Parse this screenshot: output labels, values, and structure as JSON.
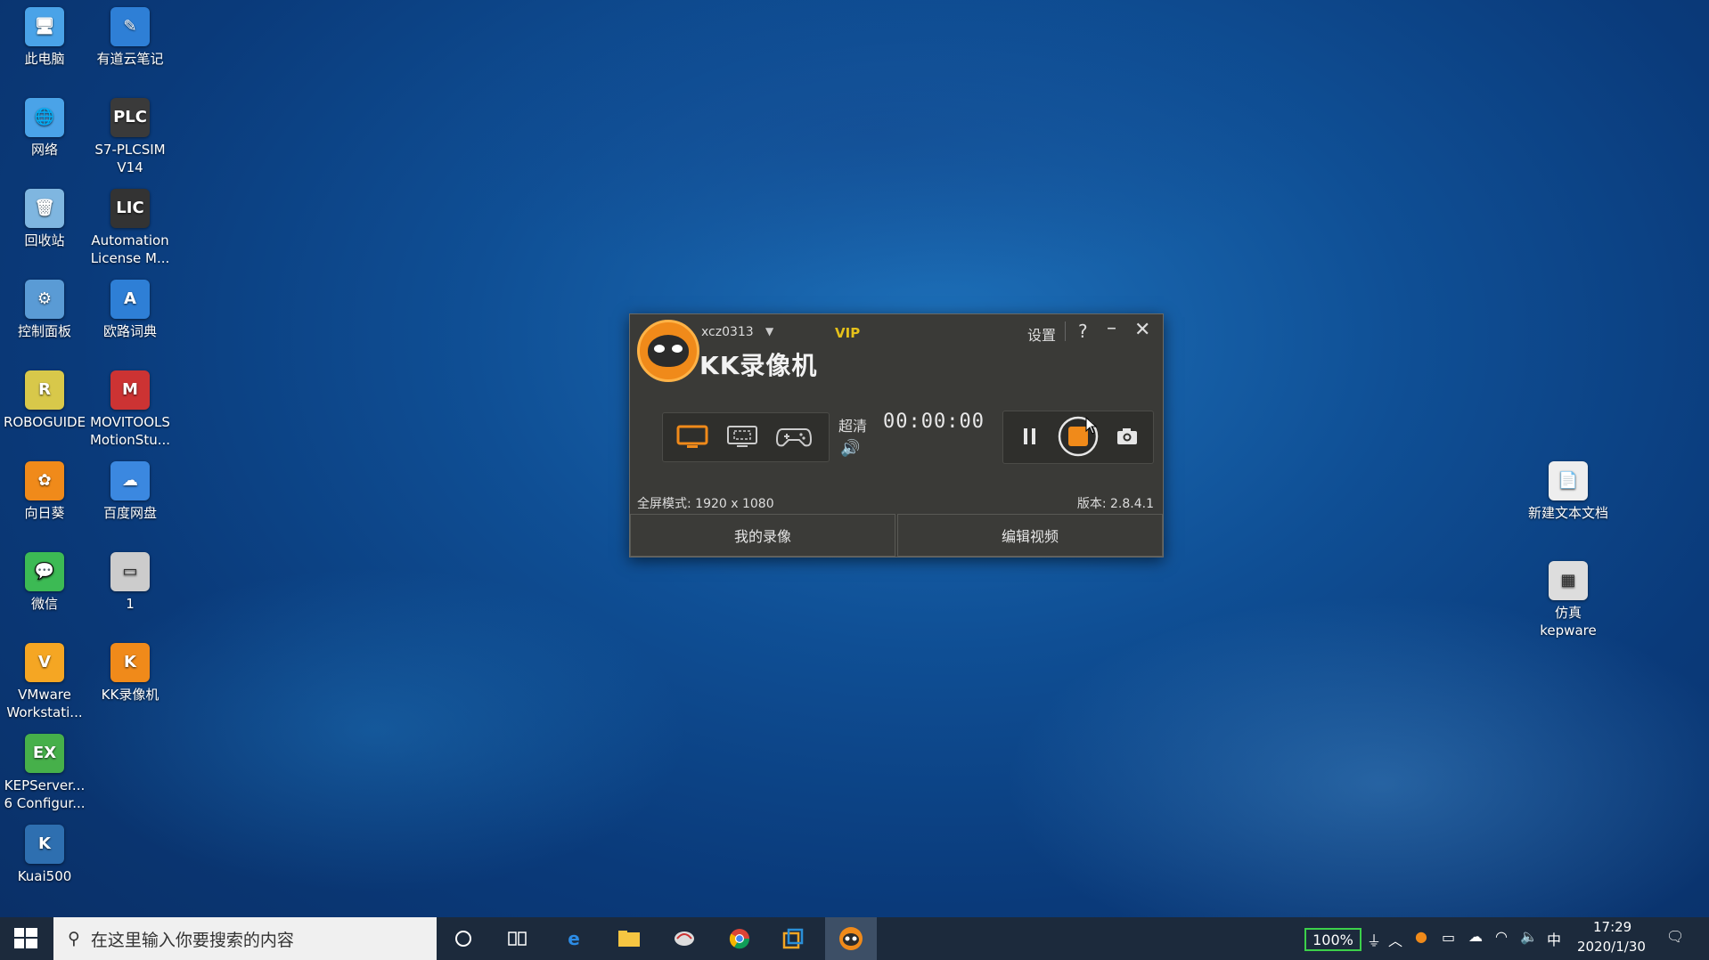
{
  "desktop": {
    "icons": [
      {
        "label": "此电脑",
        "glyph": "🖥"
      },
      {
        "label": "有道云笔记",
        "glyph": "✎"
      },
      {
        "label": "网络",
        "glyph": "🌐"
      },
      {
        "label": "S7-PLCSIM V14",
        "glyph": "PLC"
      },
      {
        "label": "回收站",
        "glyph": "🗑"
      },
      {
        "label": "Automation License M...",
        "glyph": "LIC"
      },
      {
        "label": "控制面板",
        "glyph": "⚙"
      },
      {
        "label": "欧路词典",
        "glyph": "A"
      },
      {
        "label": "ROBOGUIDE",
        "glyph": "R"
      },
      {
        "label": "MOVITOOLS MotionStu...",
        "glyph": "M"
      },
      {
        "label": "向日葵",
        "glyph": "✿"
      },
      {
        "label": "百度网盘",
        "glyph": "☁"
      },
      {
        "label": "微信",
        "glyph": "💬"
      },
      {
        "label": "1",
        "glyph": "▭"
      },
      {
        "label": "VMware Workstati...",
        "glyph": "V"
      },
      {
        "label": "KK录像机",
        "glyph": "K"
      },
      {
        "label": "KEPServer... 6 Configur...",
        "glyph": "EX"
      },
      {
        "label": "Kuai500",
        "glyph": "K"
      },
      {
        "label": "新建文本文档",
        "glyph": "📄"
      },
      {
        "label": "仿真 kepware",
        "glyph": "▦"
      }
    ]
  },
  "kk": {
    "username": "xcz0313",
    "vip": "VIP",
    "settings": "设置",
    "help": "?",
    "minimize": "–",
    "close": "✕",
    "title": "KK录像机",
    "quality": "超清",
    "timer": "00:00:00",
    "info_left": "全屏模式: 1920 x 1080",
    "info_right": "版本: 2.8.4.1",
    "tab_my_recordings": "我的录像",
    "tab_edit_video": "编辑视频"
  },
  "taskbar": {
    "search_placeholder": "在这里输入你要搜索的内容",
    "battery": "100%",
    "ime": "中",
    "time": "17:29",
    "date": "2020/1/30"
  },
  "colors": {
    "accent_orange": "#f08a1a",
    "vip_gold": "#e5c11a",
    "window_bg": "#3a3a37"
  }
}
